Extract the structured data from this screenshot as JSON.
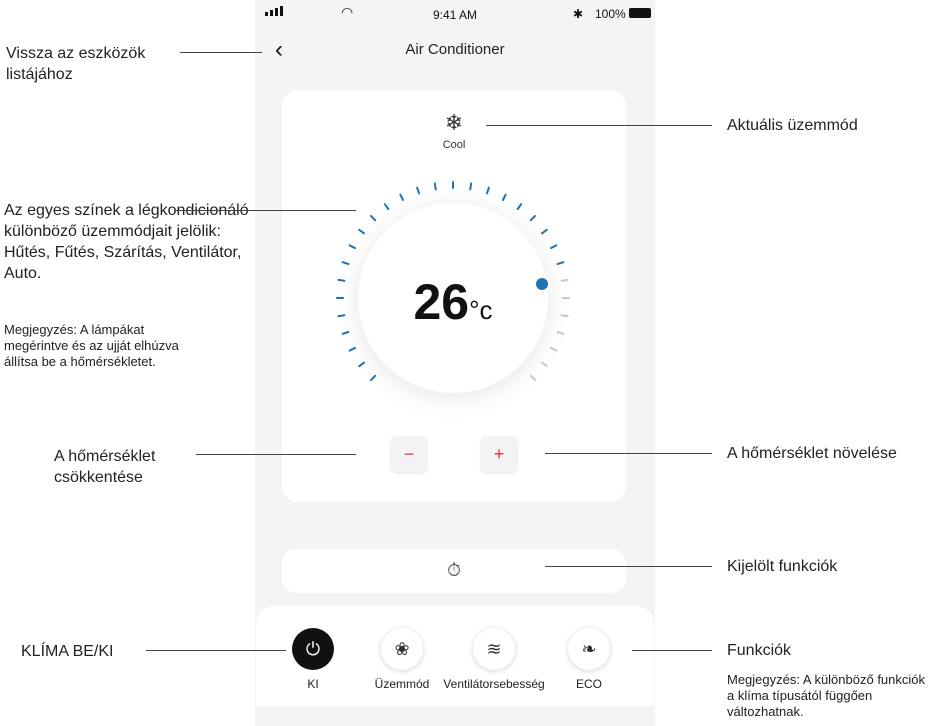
{
  "status_bar": {
    "time": "9:41 AM",
    "bluetooth_icon": "bluetooth-icon",
    "battery": "100%"
  },
  "header": {
    "back_icon": "chevron-left-icon",
    "title": "Air Conditioner"
  },
  "mode": {
    "icon": "snowflake-icon",
    "label": "Cool"
  },
  "temperature": {
    "value": "26",
    "unit": "°c",
    "minus_label": "−",
    "plus_label": "+"
  },
  "selected_functions": {
    "icon": "timer-icon"
  },
  "bottom_bar": {
    "items": [
      {
        "label": "KI",
        "icon": "power-icon"
      },
      {
        "label": "Üzemmód",
        "icon": "mode-icon"
      },
      {
        "label": "Ventilátorsebesség",
        "icon": "wind-icon"
      },
      {
        "label": "ECO",
        "icon": "leaf-icon"
      }
    ]
  },
  "annotations": {
    "back": "Vissza az eszközök listájához",
    "current_mode": "Aktuális üzemmód",
    "colors": "Az egyes színek a légkondicionáló különböző üzemmódjait jelölik: Hűtés, Fűtés, Szárítás, Ventilátor, Auto.",
    "colors_note": "Megjegyzés: A lámpákat megérintve és az ujját elhúzva állítsa be a hőmérsékletet.",
    "decrease": "A hőmérséklet csökkentése",
    "increase": "A hőmérséklet növelése",
    "selected_functions": "Kijelölt funkciók",
    "power": "KLÍMA BE/KI",
    "functions": "Funkciók",
    "functions_note": "Megjegyzés: A különböző funkciók a klíma típusától függően változhatnak."
  },
  "colors": {
    "accent_blue": "#1e73b4",
    "minus_plus_red": "#e23a3a",
    "inactive_tick": "#c8c8c8"
  }
}
